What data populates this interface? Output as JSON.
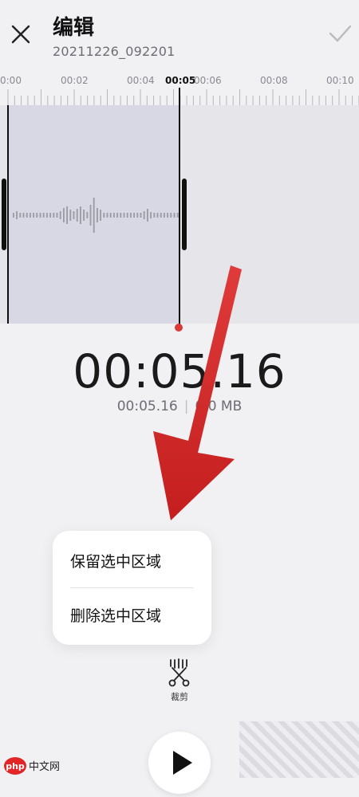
{
  "header": {
    "title": "编辑",
    "subtitle": "20211226_092201",
    "close_icon": "close-icon",
    "confirm_icon": "check-icon"
  },
  "ruler": {
    "labels": [
      "0:00",
      "00:02",
      "00:04",
      "00:05",
      "00:06",
      "00:08",
      "00:10"
    ],
    "active_label": "00:05"
  },
  "waveform": {
    "selection_color": "#d7d8e4",
    "playhead_dot_color": "#d93a3a"
  },
  "time": {
    "current": "00:05.16",
    "duration": "00:05.16",
    "size": "0.0 MB",
    "size_visible": "0",
    "size_unit": "0 MB"
  },
  "popup": {
    "keep_label": "保留选中区域",
    "delete_label": "删除选中区域"
  },
  "toolbar": {
    "trim_label": "裁剪",
    "trim_icon": "scissors-icon",
    "play_icon": "play-icon"
  },
  "watermark": {
    "text": "php 中文网"
  },
  "colors": {
    "background": "#f1f1f4",
    "annotation_arrow": "#d42a2a"
  }
}
